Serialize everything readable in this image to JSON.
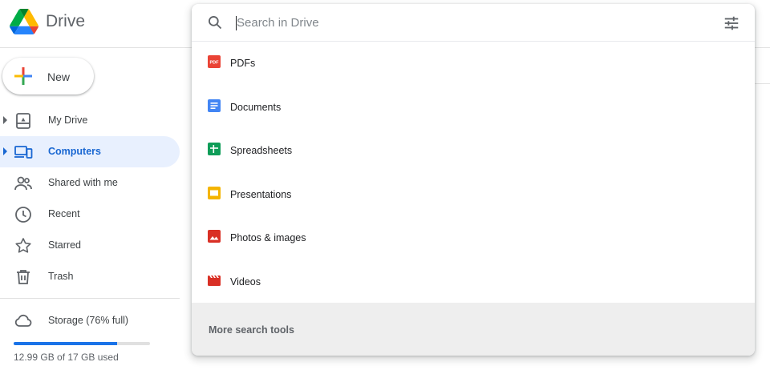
{
  "app": {
    "name": "Drive"
  },
  "sidebar": {
    "new_label": "New",
    "items": [
      {
        "label": "My Drive",
        "icon": "my-drive-icon",
        "expandable": true,
        "active": false
      },
      {
        "label": "Computers",
        "icon": "computers-icon",
        "expandable": true,
        "active": true
      },
      {
        "label": "Shared with me",
        "icon": "people-icon",
        "expandable": false,
        "active": false
      },
      {
        "label": "Recent",
        "icon": "clock-icon",
        "expandable": false,
        "active": false
      },
      {
        "label": "Starred",
        "icon": "star-icon",
        "expandable": false,
        "active": false
      },
      {
        "label": "Trash",
        "icon": "trash-icon",
        "expandable": false,
        "active": false
      }
    ],
    "storage": {
      "label": "Storage (76% full)",
      "used_text": "12.99 GB of 17 GB used",
      "percent": 76
    }
  },
  "search": {
    "placeholder": "Search in Drive",
    "value": "",
    "file_types": [
      {
        "label": "PDFs",
        "icon": "pdf-icon"
      },
      {
        "label": "Documents",
        "icon": "docs-icon"
      },
      {
        "label": "Spreadsheets",
        "icon": "sheets-icon"
      },
      {
        "label": "Presentations",
        "icon": "slides-icon"
      },
      {
        "label": "Photos & images",
        "icon": "image-icon"
      },
      {
        "label": "Videos",
        "icon": "video-icon"
      }
    ],
    "more_tools_label": "More search tools"
  },
  "colors": {
    "accent": "#1a73e8",
    "active_bg": "#e8f0fe",
    "active_text": "#1967d2",
    "pdf": "#ea4335",
    "docs": "#4285f4",
    "sheets": "#0f9d58",
    "slides": "#f4b400",
    "images": "#d93025",
    "video": "#d93025"
  }
}
